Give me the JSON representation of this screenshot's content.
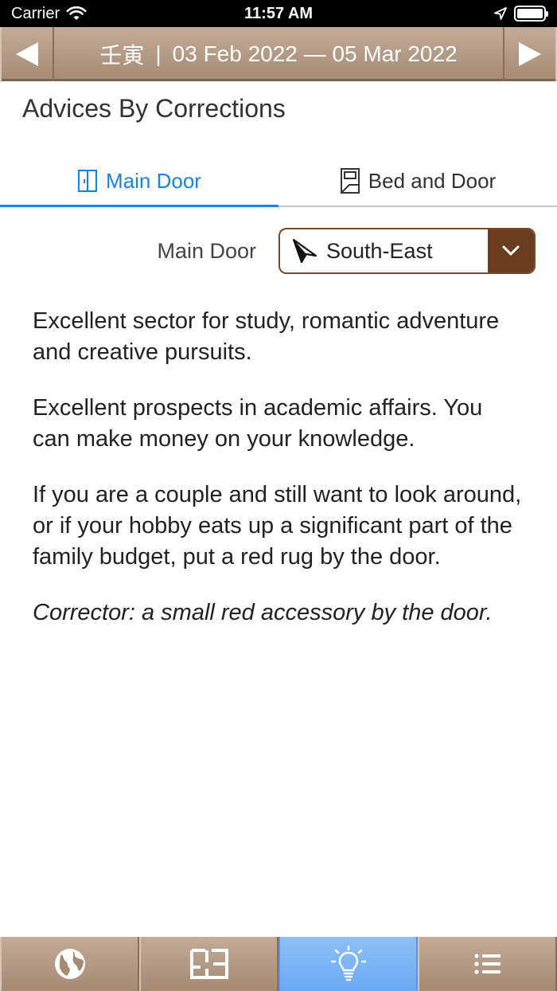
{
  "status_bar": {
    "carrier": "Carrier",
    "time": "11:57 AM"
  },
  "period": {
    "branch": "壬寅",
    "separator": "|",
    "range": "03 Feb 2022 — 05 Mar 2022"
  },
  "page": {
    "title": "Advices By Corrections"
  },
  "tabs": [
    {
      "label": "Main Door",
      "icon": "door-icon",
      "active": true
    },
    {
      "label": "Bed and Door",
      "icon": "bed-door-icon",
      "active": false
    }
  ],
  "selector": {
    "label": "Main Door",
    "value": "South-East",
    "icon": "compass-arrow-icon"
  },
  "advice": {
    "paragraph_1": "Excellent sector for study, romantic adventure and creative pursuits.",
    "paragraph_2": "Excellent prospects in academic affairs. You can make money on your knowledge.",
    "paragraph_3": "If you are a couple and still want to look around, or if your hobby eats up a significant part of the family budget, put a red rug by the door.",
    "corrector": "Corrector: a small red accessory by the door."
  },
  "bottom_tabs": [
    {
      "icon": "globe-icon",
      "active": false
    },
    {
      "icon": "floorplan-icon",
      "active": false
    },
    {
      "icon": "lightbulb-icon",
      "active": true
    },
    {
      "icon": "list-icon",
      "active": false
    }
  ],
  "colors": {
    "accent": "#1a82e0",
    "header_brown": "#a58a74",
    "select_brown": "#6b3d1f",
    "active_blue": "#6aa9f3"
  }
}
